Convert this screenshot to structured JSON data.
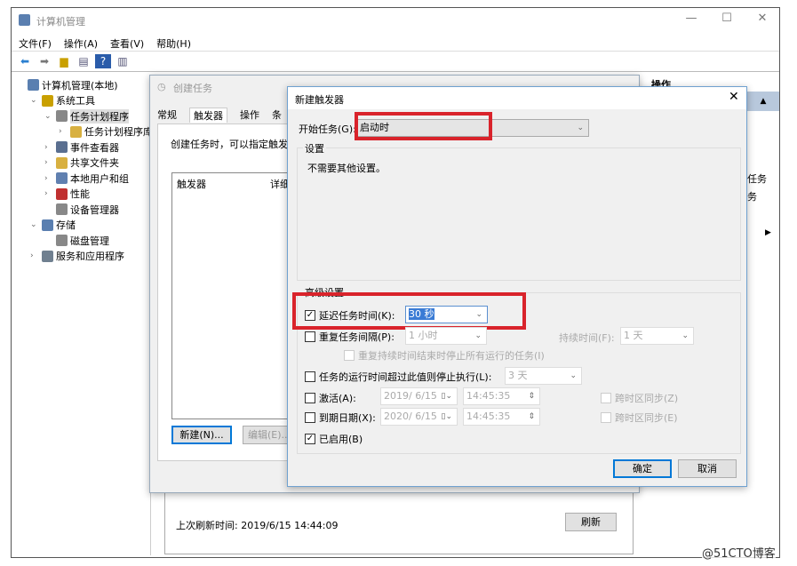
{
  "window": {
    "title": "计算机管理",
    "minimize": "—",
    "maximize": "☐",
    "close": "✕"
  },
  "menu": [
    "文件(F)",
    "操作(A)",
    "查看(V)",
    "帮助(H)"
  ],
  "tree": [
    {
      "label": "计算机管理(本地)",
      "level": 0,
      "chev": ""
    },
    {
      "label": "系统工具",
      "level": 1,
      "chev": "v"
    },
    {
      "label": "任务计划程序",
      "level": 2,
      "chev": "v",
      "selected": true
    },
    {
      "label": "任务计划程序库",
      "level": 3,
      "chev": ">"
    },
    {
      "label": "事件查看器",
      "level": 2,
      "chev": ">"
    },
    {
      "label": "共享文件夹",
      "level": 2,
      "chev": ">"
    },
    {
      "label": "本地用户和组",
      "level": 2,
      "chev": ">"
    },
    {
      "label": "性能",
      "level": 2,
      "chev": ">"
    },
    {
      "label": "设备管理器",
      "level": 2,
      "chev": ""
    },
    {
      "label": "存储",
      "level": 1,
      "chev": "v"
    },
    {
      "label": "磁盘管理",
      "level": 2,
      "chev": ""
    },
    {
      "label": "服务和应用程序",
      "level": 1,
      "chev": ">"
    }
  ],
  "actions": {
    "header": "操作",
    "item1": "任务",
    "item2": "务"
  },
  "create_task": {
    "title": "创建任务",
    "tabs": [
      "常规",
      "触发器",
      "操作",
      "条"
    ],
    "description": "创建任务时，可以指定触发该",
    "columns": [
      "触发器",
      "详细"
    ],
    "new_button": "新建(N)...",
    "edit_button": "编辑(E)..."
  },
  "bottom": {
    "last_refresh": "上次刷新时间: 2019/6/15 14:44:09",
    "refresh_button": "刷新"
  },
  "trigger_dialog": {
    "title": "新建触发器",
    "begin_label": "开始任务(G):",
    "begin_value": "启动时",
    "settings_label": "设置",
    "settings_text": "不需要其他设置。",
    "advanced_label": "高级设置",
    "delay": {
      "label": "延迟任务时间(K):",
      "value": "30 秒",
      "checked": true
    },
    "repeat": {
      "label": "重复任务间隔(P):",
      "value": "1 小时",
      "checked": false,
      "duration_label": "持续时间(F):",
      "duration_value": "1 天"
    },
    "stop_all": {
      "label": "重复持续时间结束时停止所有运行的任务(I)",
      "checked": false
    },
    "stop_after": {
      "label": "任务的运行时间超过此值则停止执行(L):",
      "value": "3 天",
      "checked": false
    },
    "activate": {
      "label": "激活(A):",
      "date": "2019/  6/15",
      "time": "14:45:35",
      "sync": "跨时区同步(Z)",
      "checked": false
    },
    "expire": {
      "label": "到期日期(X):",
      "date": "2020/  6/15",
      "time": "14:45:35",
      "sync": "跨时区同步(E)",
      "checked": false
    },
    "enabled": {
      "label": "已启用(B)",
      "checked": true
    },
    "ok": "确定",
    "cancel": "取消",
    "close": "✕"
  },
  "watermark": "@51CTO博客",
  "colors": {
    "highlight": "#d9232b",
    "accent": "#0078d7"
  }
}
